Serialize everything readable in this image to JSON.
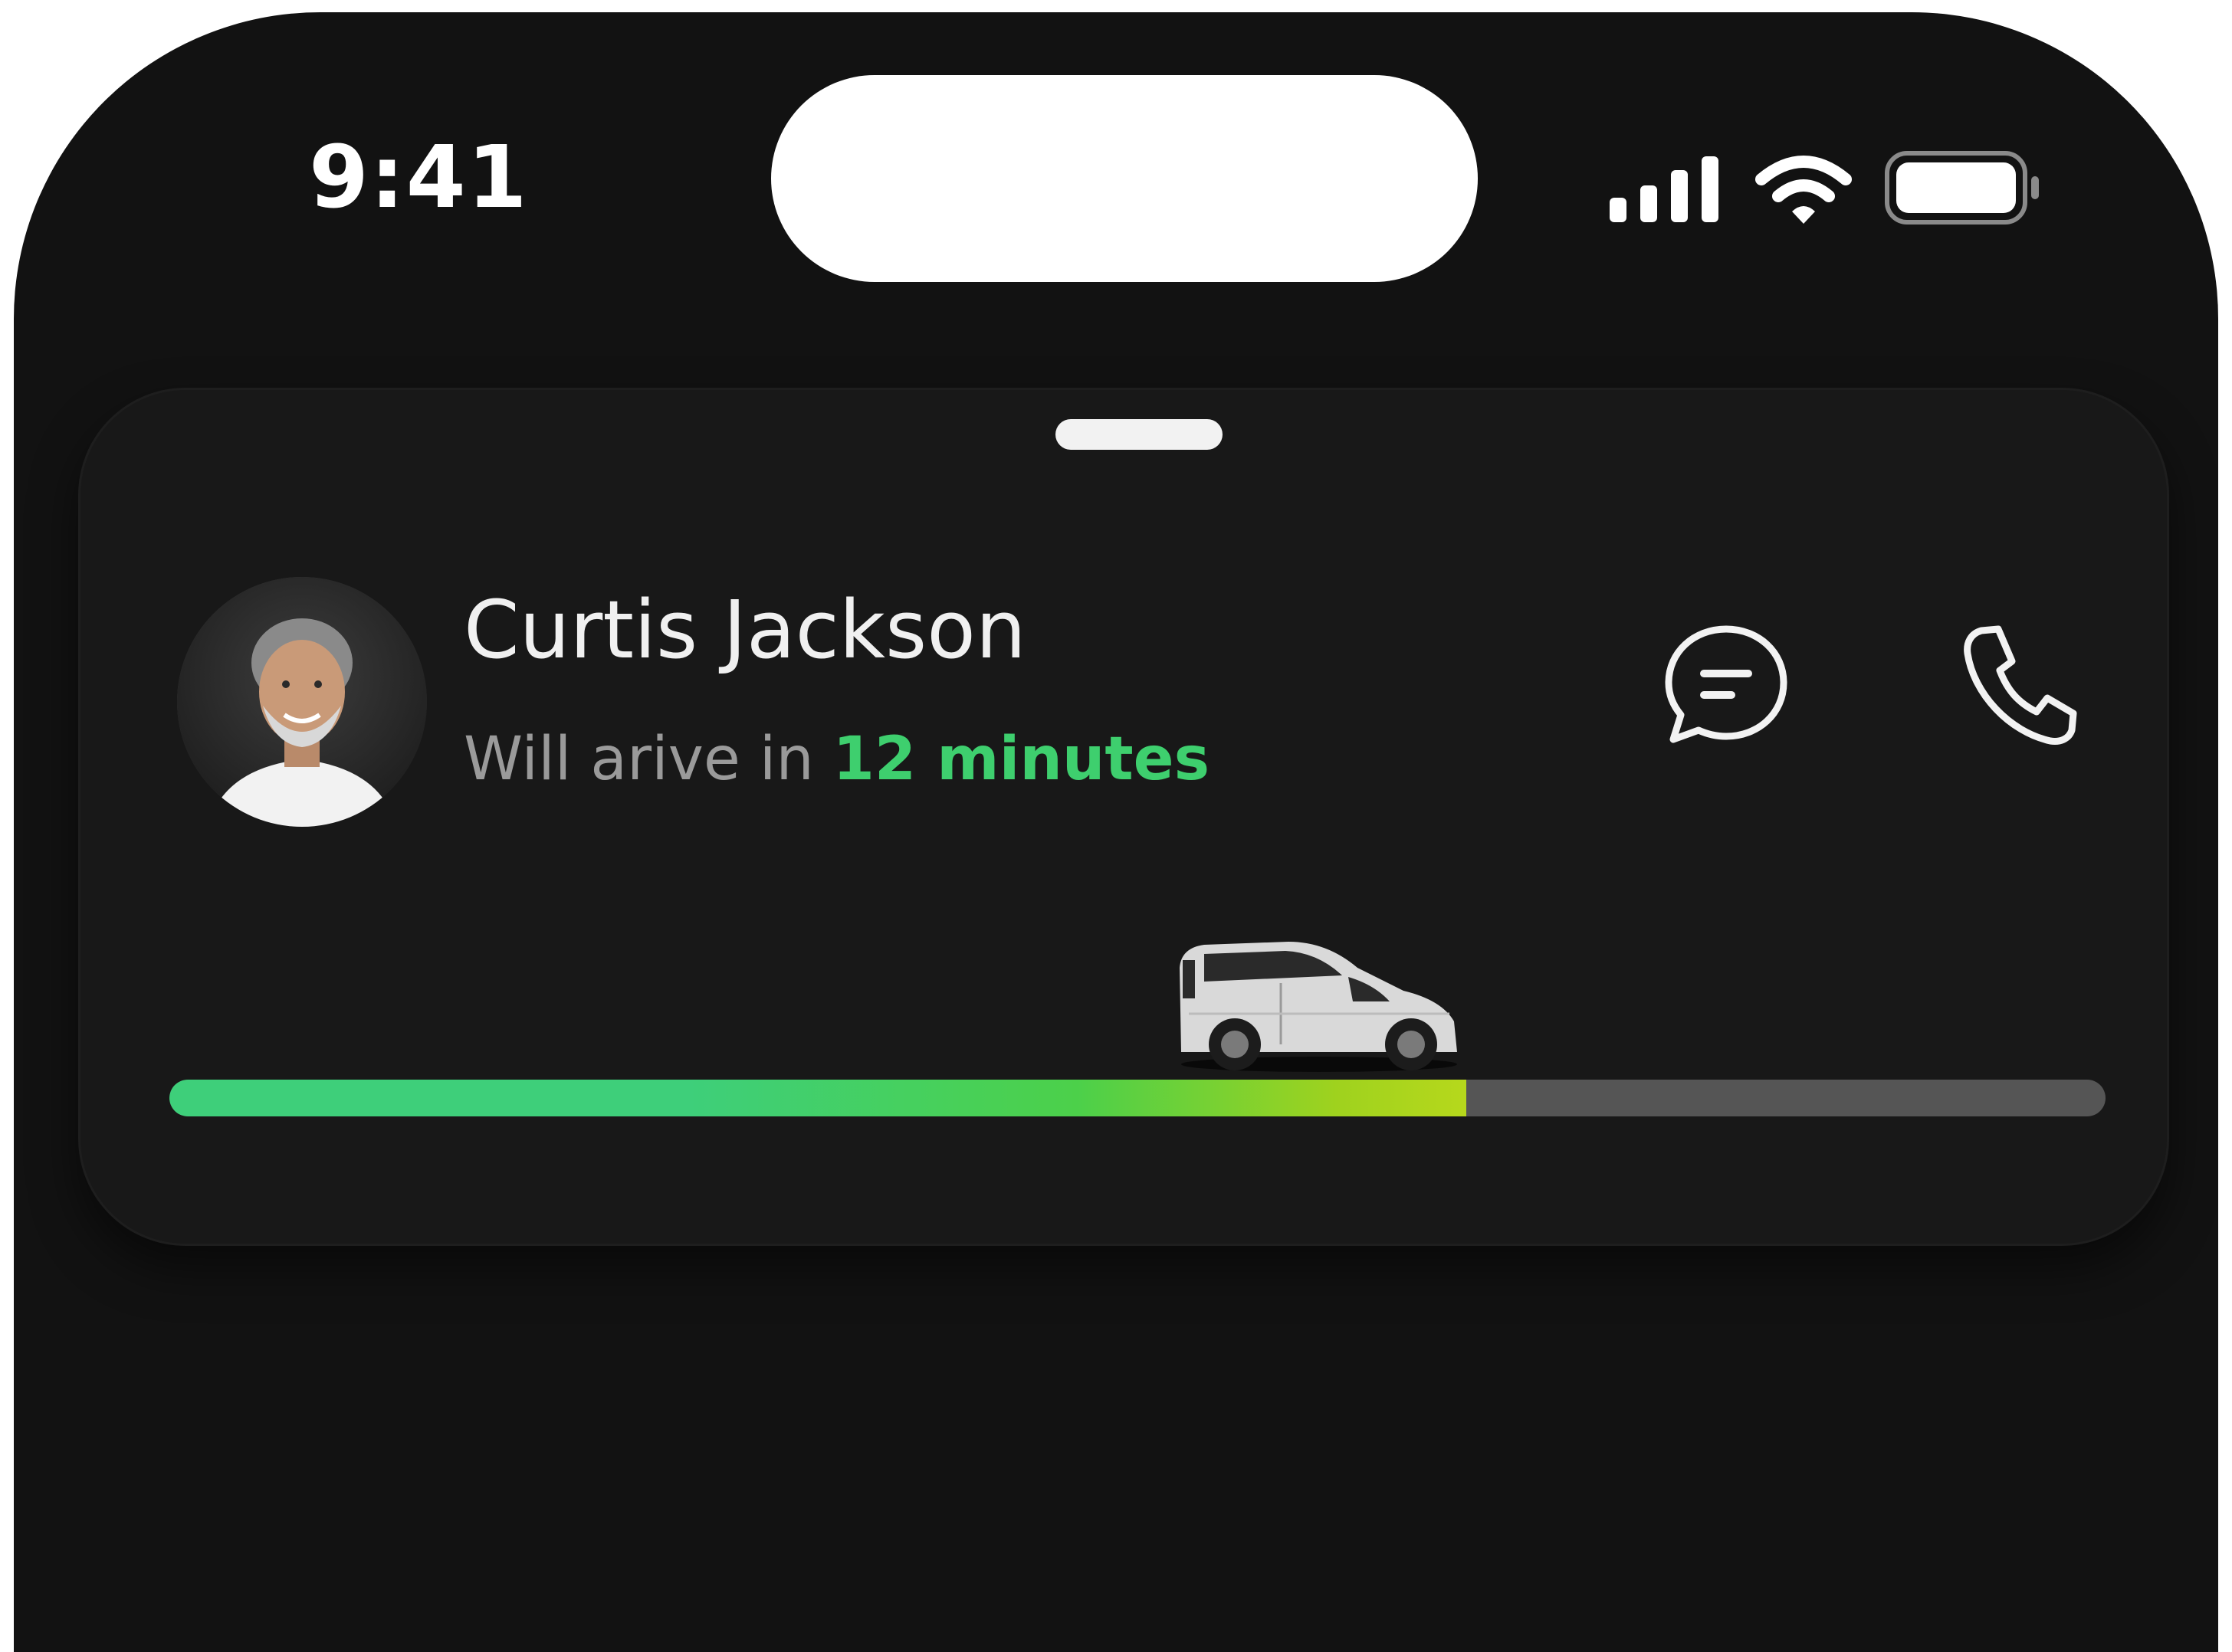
{
  "status_bar": {
    "time": "9:41",
    "icons": [
      "signal-icon",
      "wifi-icon",
      "battery-icon"
    ]
  },
  "driver_card": {
    "name": "Curtis Jackson",
    "eta_prefix": "Will arive in ",
    "eta_value": "12 minutes",
    "actions": [
      {
        "icon": "message-icon"
      },
      {
        "icon": "phone-icon"
      }
    ],
    "trip_progress": 0.67
  },
  "colors": {
    "background": "#121212",
    "card": "#181818",
    "accent": "#3ecf6e",
    "progress_end": "#b6d81c",
    "track": "#555555"
  }
}
